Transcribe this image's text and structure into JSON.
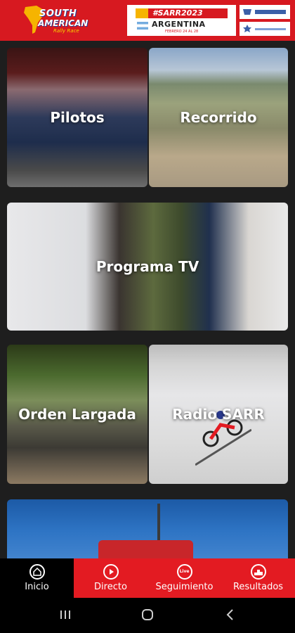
{
  "header": {
    "logo": {
      "line1": "SOUTH",
      "line2": "AMERICAN",
      "line3": "Rally Race"
    },
    "event": {
      "title": "#SARR2023",
      "country": "ARGENTINA",
      "dates": "FEBRERO 24 AL 28"
    },
    "colors": {
      "brand_red": "#d71920",
      "accent_yellow": "#f6b400"
    }
  },
  "tiles": [
    {
      "label": "Pilotos"
    },
    {
      "label": "Recorrido"
    },
    {
      "label": "Programa TV"
    },
    {
      "label": "Orden Largada"
    },
    {
      "label": "Radio SARR"
    },
    {
      "label": ""
    }
  ],
  "tabbar": {
    "items": [
      {
        "label": "Inicio",
        "icon": "home-icon",
        "active": true
      },
      {
        "label": "Directo",
        "icon": "play-icon",
        "active": false
      },
      {
        "label": "Seguimiento",
        "icon": "live-icon",
        "active": false,
        "badge": "Live"
      },
      {
        "label": "Resultados",
        "icon": "podium-icon",
        "active": false
      }
    ],
    "colors": {
      "bar": "#e31b22",
      "active_bg": "#000000"
    }
  },
  "system_nav": {
    "items": [
      "recent-apps-icon",
      "home-circle-icon",
      "back-icon"
    ]
  }
}
